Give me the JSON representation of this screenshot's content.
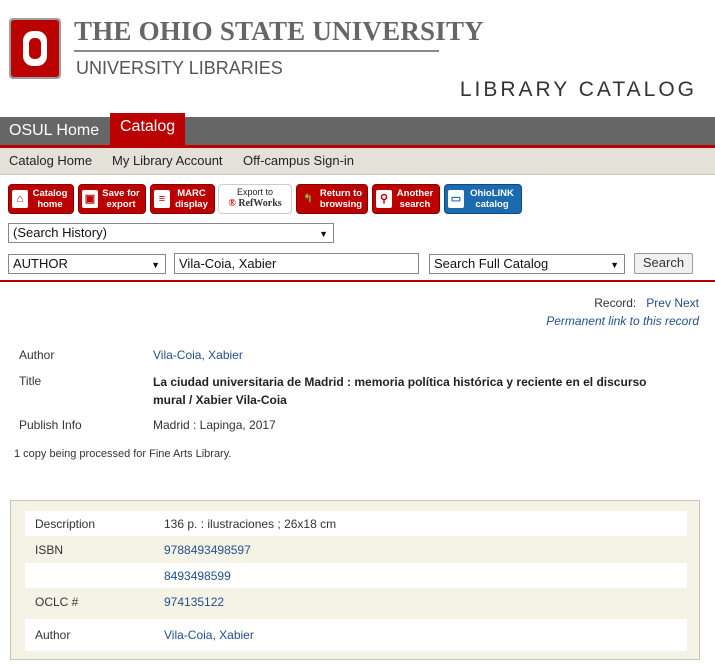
{
  "header": {
    "university": "The Ohio State University",
    "libraries": "UNIVERSITY LIBRARIES",
    "catalog_title": "LIBRARY CATALOG",
    "logo_letter": "O"
  },
  "topnav": {
    "home": "OSUL Home",
    "catalog": "Catalog"
  },
  "subnav": {
    "catalog_home": "Catalog Home",
    "my_account": "My Library Account",
    "offcampus": "Off-campus Sign-in"
  },
  "toolbar": [
    {
      "line1": "Catalog",
      "line2": "home",
      "icon": "home-icon",
      "glyph": "⌂"
    },
    {
      "line1": "Save for",
      "line2": "export",
      "icon": "disk-icon",
      "glyph": "▣"
    },
    {
      "line1": "MARC",
      "line2": "display",
      "icon": "list-icon",
      "glyph": "≡"
    },
    {
      "line1": "Export to",
      "line2": "RefWorks",
      "icon": "refworks-icon",
      "glyph": "®"
    },
    {
      "line1": "Return to",
      "line2": "browsing",
      "icon": "return-arrow-icon",
      "glyph": "↰"
    },
    {
      "line1": "Another",
      "line2": "search",
      "icon": "search-icon",
      "glyph": "⚲"
    },
    {
      "line1": "OhioLINK",
      "line2": "catalog",
      "icon": "book-icon",
      "glyph": "▭"
    }
  ],
  "search": {
    "history": "(Search History)",
    "field": "AUTHOR",
    "query": "Vila-Coia, Xabier",
    "scope": "Search Full Catalog",
    "button": "Search"
  },
  "record_nav": {
    "label": "Record:",
    "prev": "Prev",
    "next": "Next",
    "permalink": "Permanent link to this record"
  },
  "record": {
    "author_label": "Author",
    "author": "Vila-Coia, Xabier",
    "title_label": "Title",
    "title": "La ciudad universitaria de Madrid : memoria política histórica y reciente en el discurso mural / Xabier Vila-Coia",
    "publish_label": "Publish Info",
    "publish": "Madrid : Lapinga, 2017",
    "copy_note": "1 copy being processed for Fine Arts Library."
  },
  "details": [
    {
      "label": "Description",
      "value": "136 p. : ilustraciones ; 26x18 cm",
      "link": false
    },
    {
      "label": "ISBN",
      "value": "9788493498597",
      "link": true
    },
    {
      "label": "",
      "value": "8493498599",
      "link": true
    },
    {
      "label": "OCLC #",
      "value": "974135122",
      "link": true
    },
    {
      "label": "Author",
      "value": "Vila-Coia, Xabier",
      "link": true
    }
  ],
  "colors": {
    "osu_red": "#bb0000",
    "nav_gray": "#666666",
    "link": "#23508b"
  }
}
